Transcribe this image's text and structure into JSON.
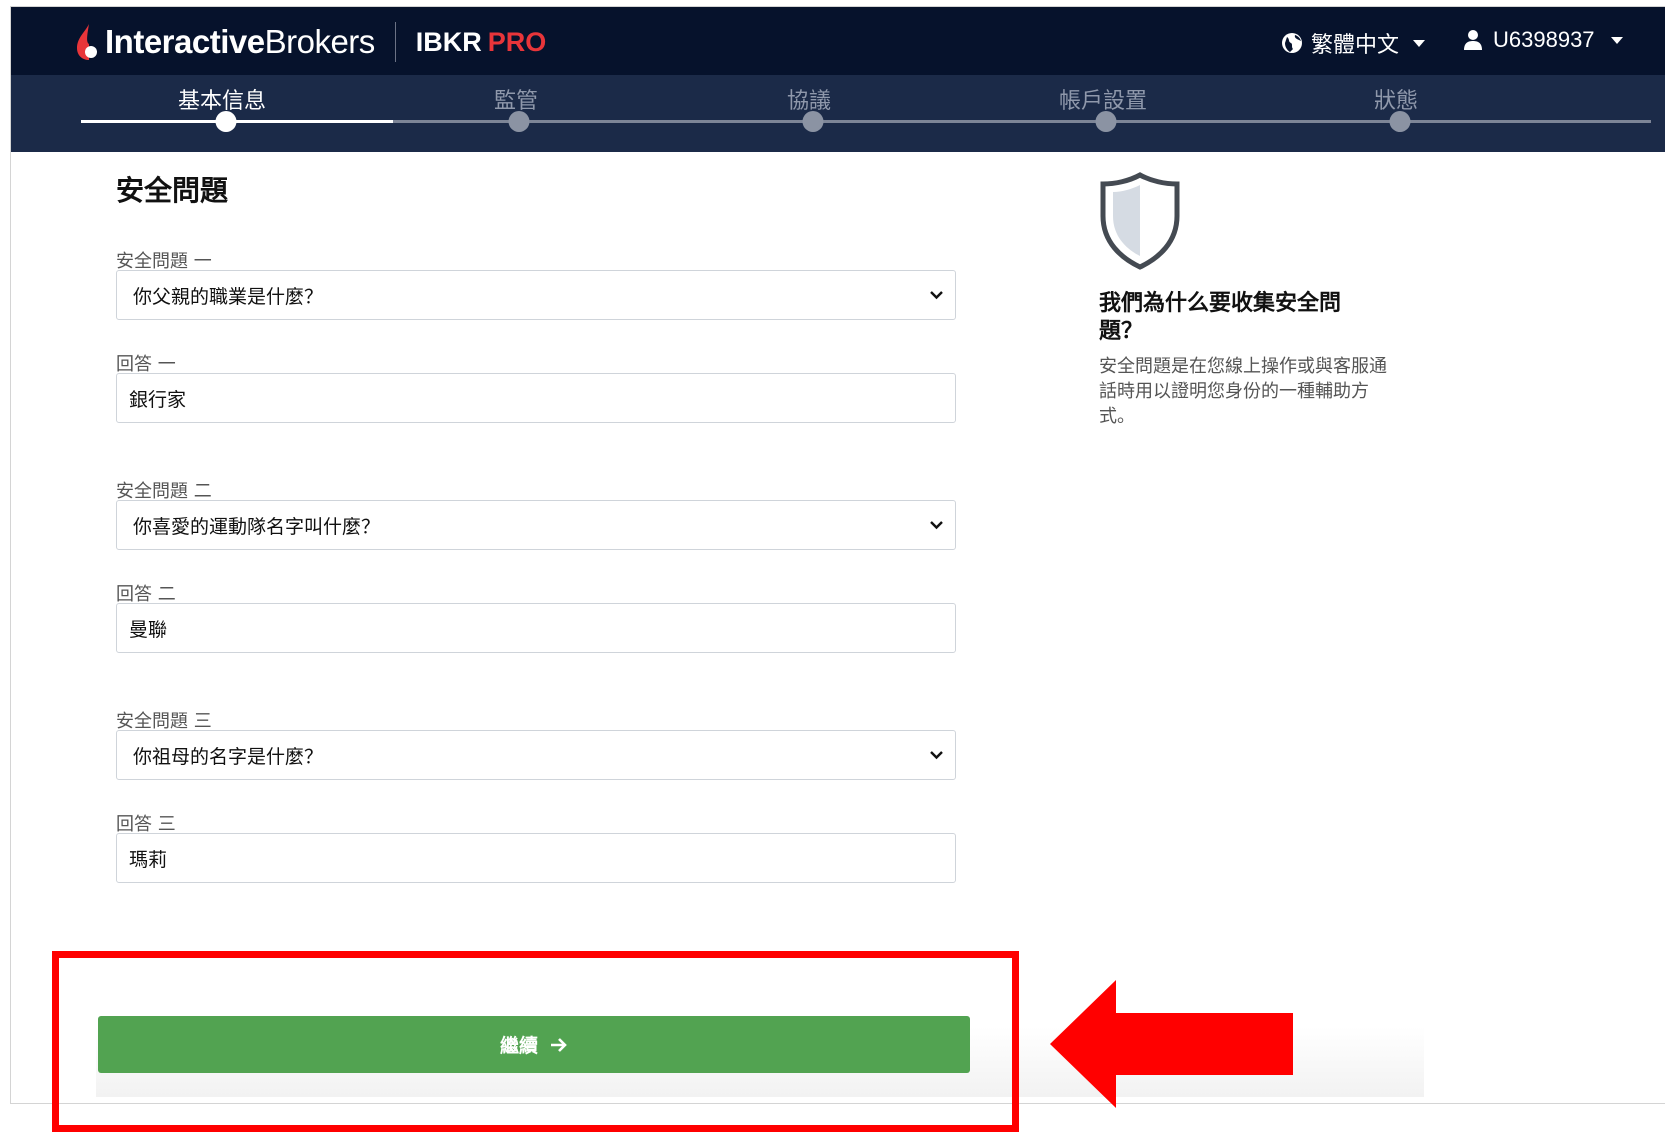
{
  "header": {
    "brand_bold": "Interactive",
    "brand_regular": "Brokers",
    "product_main": "IBKR",
    "product_accent": "PRO",
    "language": "繁體中文",
    "user_id": "U6398937"
  },
  "steps": [
    {
      "label": "基本信息",
      "active": true
    },
    {
      "label": "監管",
      "active": false
    },
    {
      "label": "協議",
      "active": false
    },
    {
      "label": "帳戶設置",
      "active": false
    },
    {
      "label": "狀態",
      "active": false
    }
  ],
  "form": {
    "title": "安全問題",
    "q1_label": "安全問題 一",
    "q1_value": "你父親的職業是什麼？",
    "a1_label": "回答 一",
    "a1_value": "銀行家",
    "q2_label": "安全問題 二",
    "q2_value": "你喜愛的運動隊名字叫什麼？",
    "a2_label": "回答 二",
    "a2_value": "曼聯",
    "q3_label": "安全問題 三",
    "q3_value": "你祖母的名字是什麼？",
    "a3_label": "回答 三",
    "a3_value": "瑪莉"
  },
  "sidebar": {
    "title": "我們為什么要收集安全問題？",
    "text": "安全問題是在您線上操作或與客服通話時用以證明您身份的一種輔助方式。"
  },
  "footer": {
    "continue_label": "繼續"
  },
  "colors": {
    "navbar": "#06122c",
    "stepbar": "#1b2a48",
    "accent_red": "#e8353a",
    "button_green": "#52a351",
    "annotation_red": "#ff0000"
  }
}
